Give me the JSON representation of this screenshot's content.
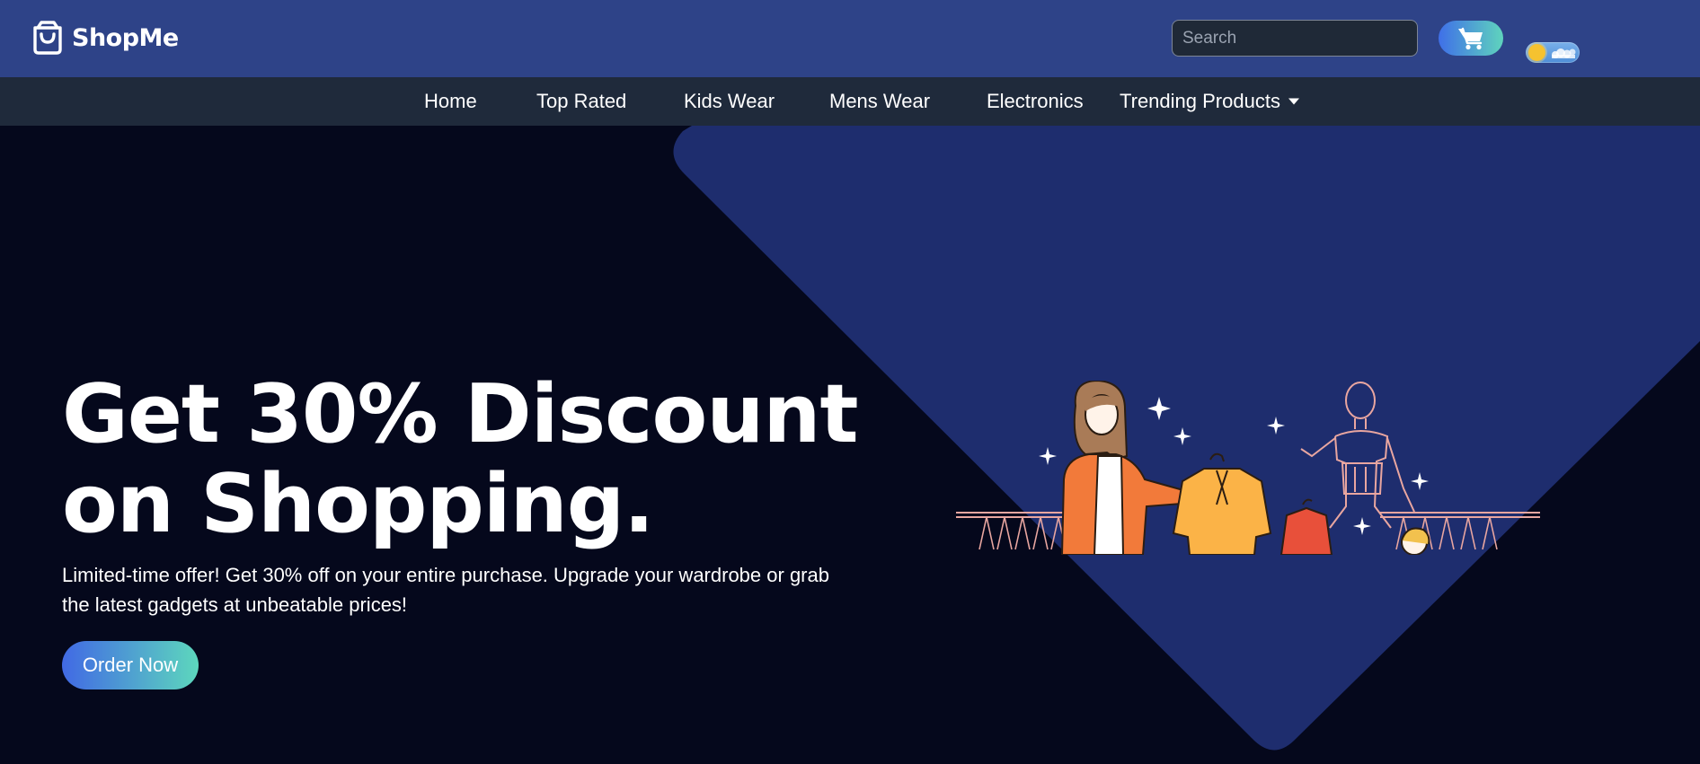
{
  "header": {
    "brand_name": "ShopMe",
    "brand_icon": "shopping-bag-icon",
    "search": {
      "placeholder": "Search",
      "value": ""
    },
    "cart_icon": "shopping-cart-icon",
    "theme_toggle": {
      "state": "light",
      "icon": "sun-icon"
    }
  },
  "nav": {
    "items": [
      {
        "label": "Home"
      },
      {
        "label": "Top Rated"
      },
      {
        "label": "Kids Wear"
      },
      {
        "label": "Mens Wear"
      },
      {
        "label": "Electronics"
      },
      {
        "label": "Trending Products",
        "icon": "caret-down-icon"
      }
    ]
  },
  "hero": {
    "headline_line1": "Get 30% Discount",
    "headline_line2": "on Shopping.",
    "description": "Limited-time offer! Get 30% off on your entire purchase. Upgrade your wardrobe or grab the latest gadgets at unbeatable prices!",
    "cta_label": "Order Now",
    "illustration": "shopping-woman-clothes-rack-illustration"
  },
  "colors": {
    "header_bg": "#2e4388",
    "nav_bg": "#1f2a3b",
    "hero_bg": "#05081c",
    "hero_shape": "#1e2d6e",
    "accent_gradient_start": "#4169e4",
    "accent_gradient_end": "#5dd7bd"
  }
}
